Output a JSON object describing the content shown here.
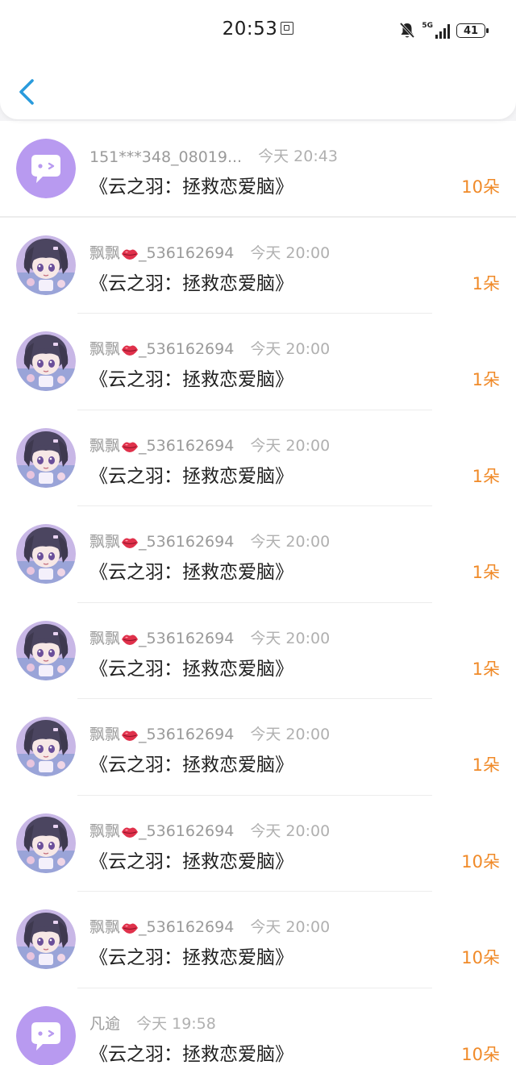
{
  "status_bar": {
    "time": "20:53",
    "network": "5G",
    "battery": "41",
    "icons": [
      "notification-card-icon",
      "bell-off-icon",
      "signal-icon",
      "battery-icon"
    ]
  },
  "nav": {
    "back_icon": "chevron-left-icon"
  },
  "colors": {
    "accent_back": "#2a9bdc",
    "amount": "#f08a28",
    "default_avatar_bg": "#b89af0"
  },
  "records": [
    {
      "sender": "151***348_08019...",
      "lips": false,
      "time": "今天 20:43",
      "title": "《云之羽：拯救恋爱脑》",
      "amount": "10朵",
      "avatar": "default"
    },
    {
      "sender": "飘飘",
      "lips": true,
      "sender_suffix": "_536162694",
      "time": "今天 20:00",
      "title": "《云之羽：拯救恋爱脑》",
      "amount": "1朵",
      "avatar": "anime"
    },
    {
      "sender": "飘飘",
      "lips": true,
      "sender_suffix": "_536162694",
      "time": "今天 20:00",
      "title": "《云之羽：拯救恋爱脑》",
      "amount": "1朵",
      "avatar": "anime"
    },
    {
      "sender": "飘飘",
      "lips": true,
      "sender_suffix": "_536162694",
      "time": "今天 20:00",
      "title": "《云之羽：拯救恋爱脑》",
      "amount": "1朵",
      "avatar": "anime"
    },
    {
      "sender": "飘飘",
      "lips": true,
      "sender_suffix": "_536162694",
      "time": "今天 20:00",
      "title": "《云之羽：拯救恋爱脑》",
      "amount": "1朵",
      "avatar": "anime"
    },
    {
      "sender": "飘飘",
      "lips": true,
      "sender_suffix": "_536162694",
      "time": "今天 20:00",
      "title": "《云之羽：拯救恋爱脑》",
      "amount": "1朵",
      "avatar": "anime"
    },
    {
      "sender": "飘飘",
      "lips": true,
      "sender_suffix": "_536162694",
      "time": "今天 20:00",
      "title": "《云之羽：拯救恋爱脑》",
      "amount": "1朵",
      "avatar": "anime"
    },
    {
      "sender": "飘飘",
      "lips": true,
      "sender_suffix": "_536162694",
      "time": "今天 20:00",
      "title": "《云之羽：拯救恋爱脑》",
      "amount": "10朵",
      "avatar": "anime"
    },
    {
      "sender": "飘飘",
      "lips": true,
      "sender_suffix": "_536162694",
      "time": "今天 20:00",
      "title": "《云之羽：拯救恋爱脑》",
      "amount": "10朵",
      "avatar": "anime"
    },
    {
      "sender": "凡逾",
      "lips": false,
      "time": "今天 19:58",
      "title": "《云之羽：拯救恋爱脑》",
      "amount": "10朵",
      "avatar": "default"
    }
  ]
}
